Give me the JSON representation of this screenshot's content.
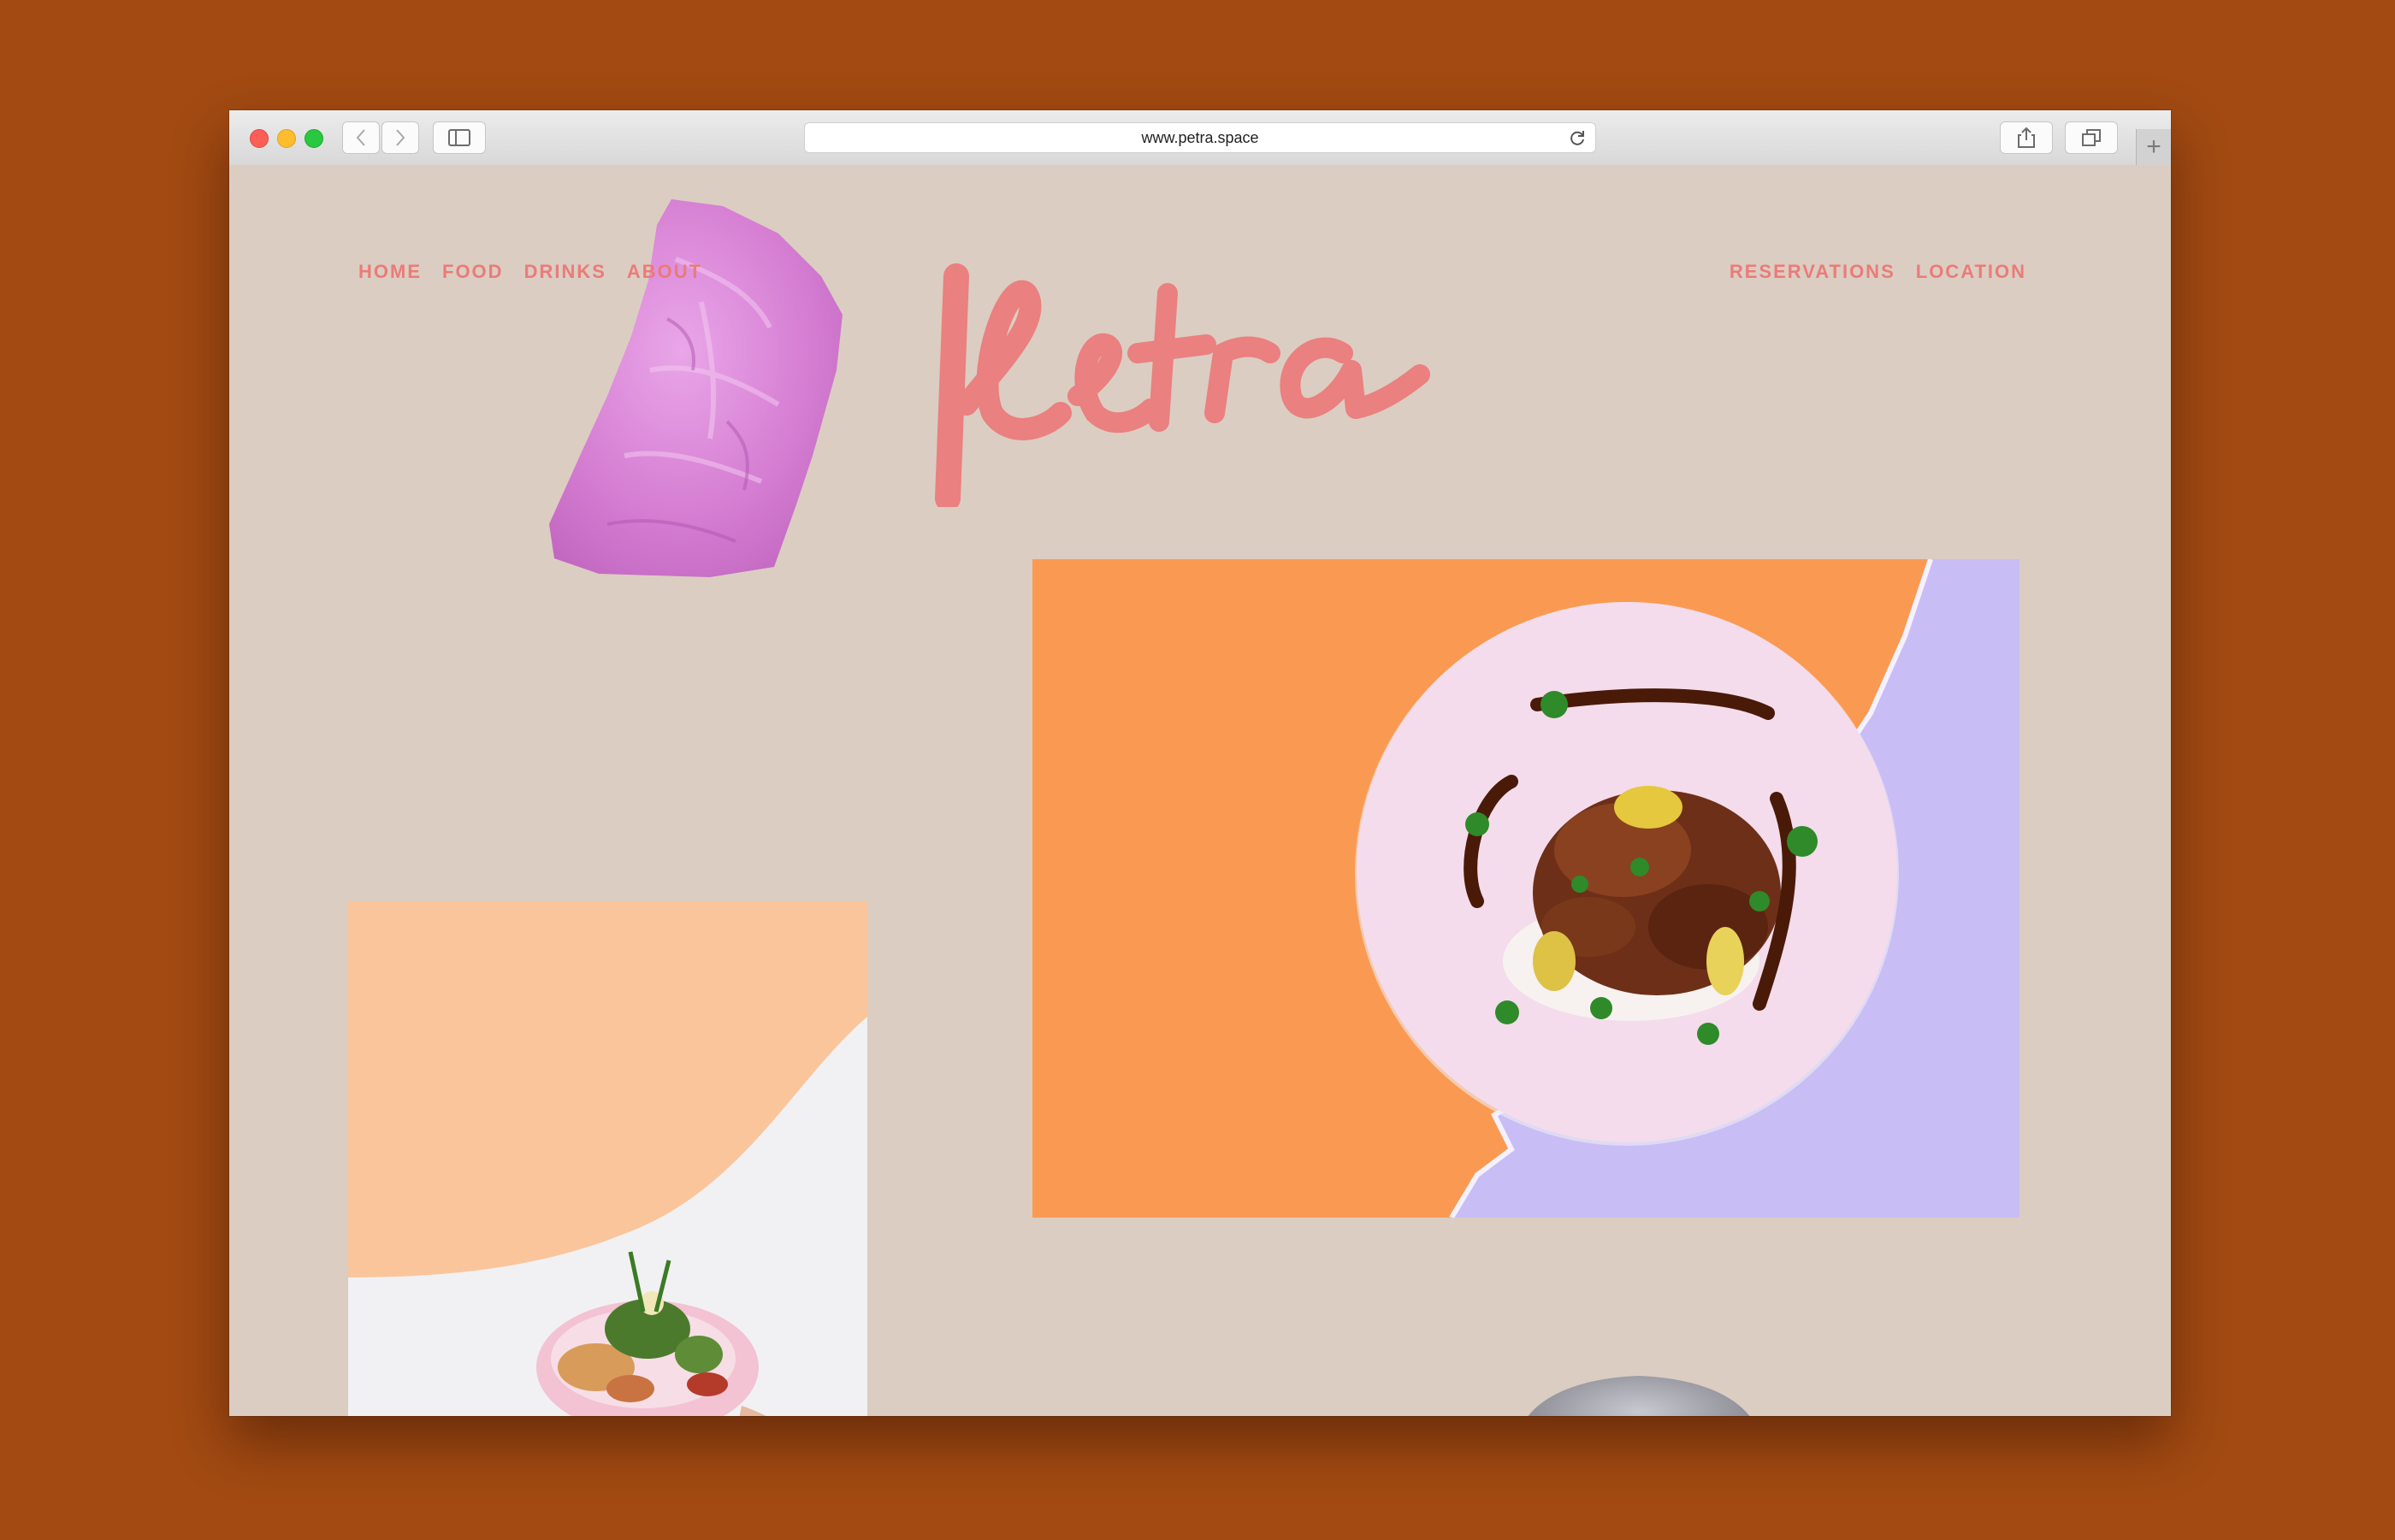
{
  "browser": {
    "url": "www.petra.space"
  },
  "site": {
    "logo_text": "Petra",
    "nav_left": [
      {
        "label": "HOME"
      },
      {
        "label": "FOOD"
      },
      {
        "label": "DRINKS"
      },
      {
        "label": "ABOUT"
      }
    ],
    "nav_right": [
      {
        "label": "RESERVATIONS"
      },
      {
        "label": "LOCATION"
      }
    ]
  },
  "colors": {
    "outer_background": "#a24a12",
    "page_background": "#dbcdc2",
    "accent_pink": "#eb7b78",
    "stone_purple": "#d67fd3",
    "photo_orange": "#fa9a52",
    "photo_lavender": "#c9bdf5"
  }
}
